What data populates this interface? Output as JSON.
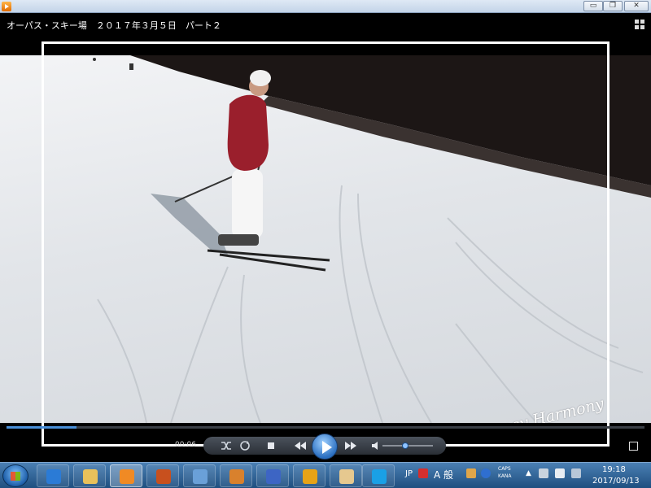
{
  "window": {
    "minimize_label": "▭",
    "restore_label": "❐",
    "close_label": "✕"
  },
  "player": {
    "video_title": "オーパス・スキー場　２０１７年３月５日　パート２",
    "current_time": "00:06",
    "progress": 0.11,
    "volume": 0.45,
    "watermark": "Marriage Agency Harmony",
    "icons": {
      "switch_view": "fit-to-window-icon",
      "shuffle": "shuffle-icon",
      "repeat": "repeat-icon",
      "stop": "stop-icon",
      "previous": "previous-icon",
      "play": "play-icon",
      "next": "next-icon",
      "mute": "speaker-icon",
      "fullscreen": "fullscreen-icon"
    }
  },
  "taskbar": {
    "apps": [
      {
        "name": "internet-explorer",
        "color": "#2b7bd6",
        "active": false
      },
      {
        "name": "file-explorer",
        "color": "#e9c15b",
        "active": false
      },
      {
        "name": "media-player",
        "color": "#f08a24",
        "active": true
      },
      {
        "name": "media-app-2",
        "color": "#c8501e",
        "active": false
      },
      {
        "name": "app-tools",
        "color": "#6aa0d8",
        "active": false
      },
      {
        "name": "app-game",
        "color": "#d9812d",
        "active": false
      },
      {
        "name": "app-stats",
        "color": "#3d65c4",
        "active": false
      },
      {
        "name": "app-headphones",
        "color": "#e7a317",
        "active": false
      },
      {
        "name": "app-paint",
        "color": "#e6c88f",
        "active": false
      },
      {
        "name": "skype",
        "color": "#1aa0e6",
        "active": false
      }
    ],
    "ime_lang": "JP",
    "ime_mode": "A 般",
    "caps": "CAPS",
    "kana": "KANA",
    "clock_time": "19:18",
    "clock_date": "2017/09/13"
  }
}
